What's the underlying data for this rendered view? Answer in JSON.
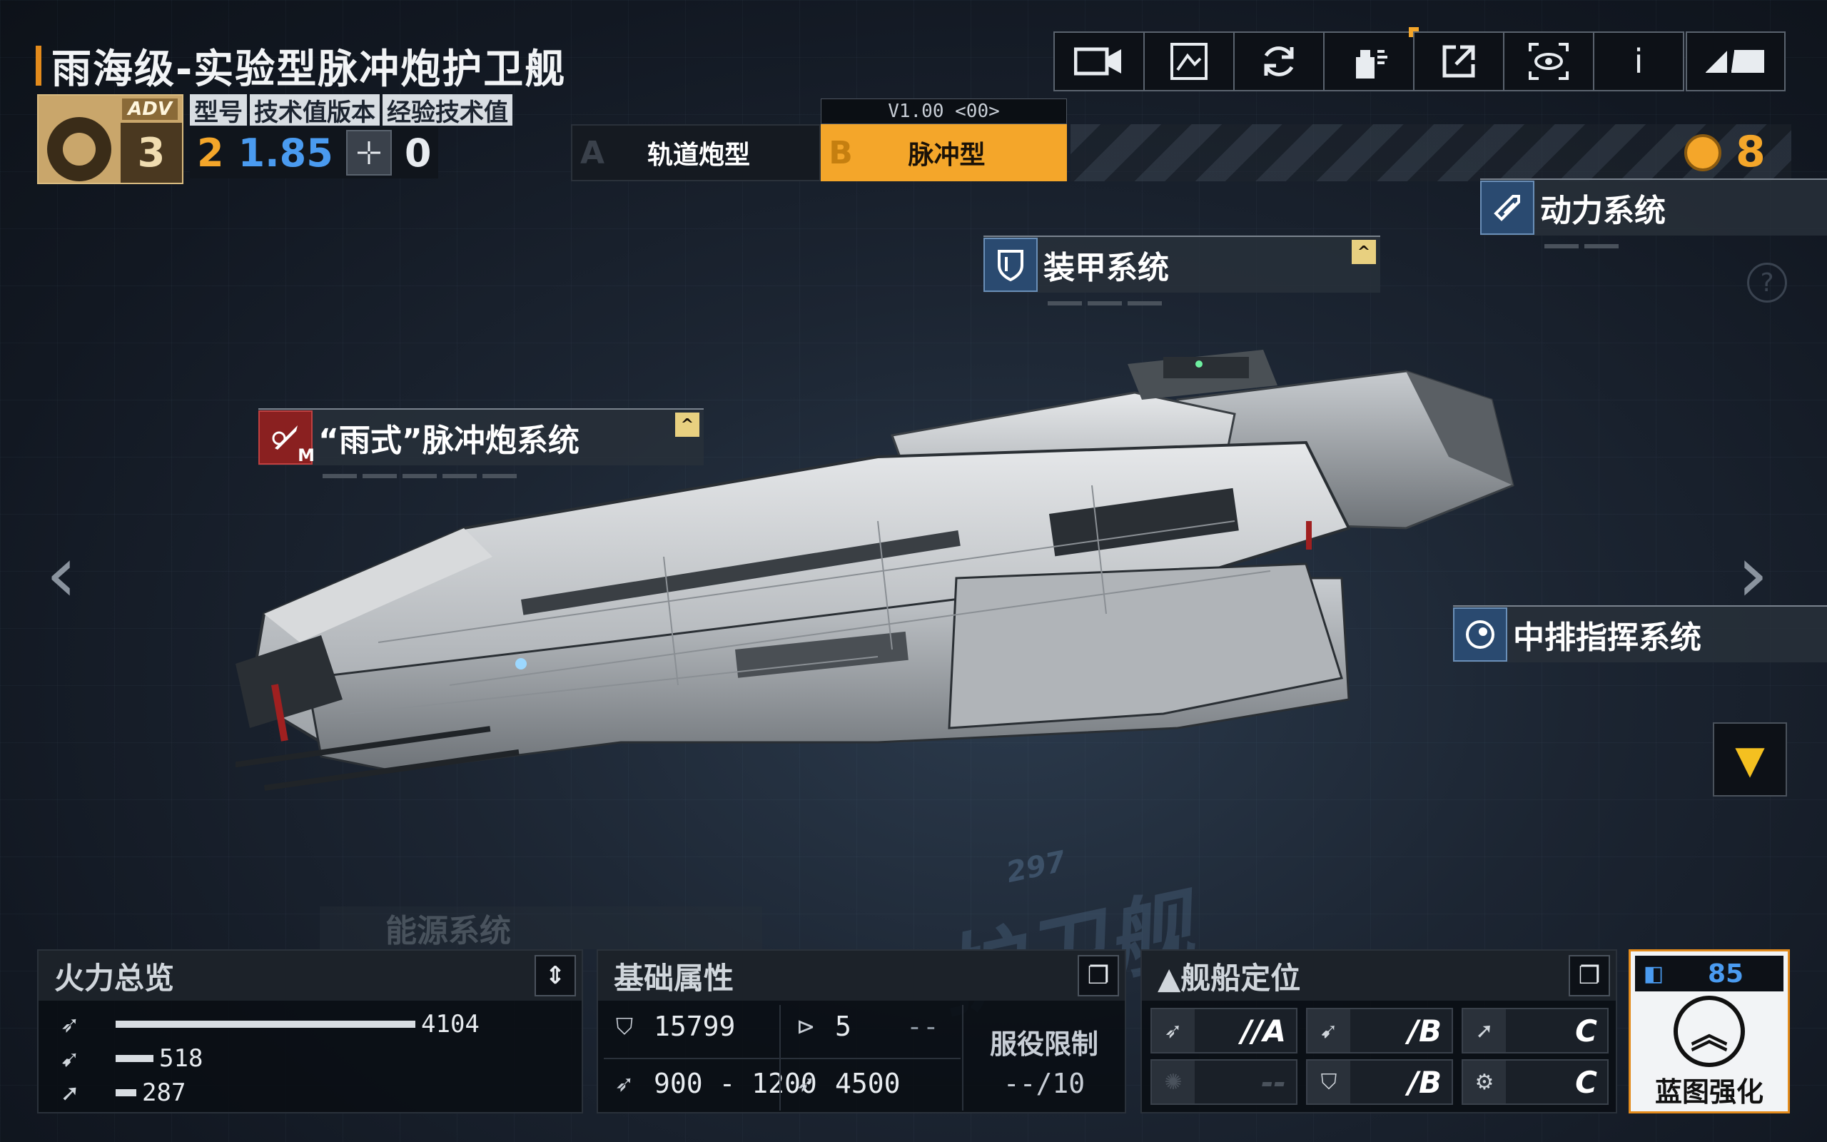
{
  "ship": {
    "title": "雨海级-实验型脉冲炮护卫舰",
    "adv_tag": "ADV",
    "adv_level": "3"
  },
  "stats": {
    "headers": [
      "型号",
      "技术值版本",
      "经验技术值"
    ],
    "model": "2",
    "tech_version": "1.85",
    "exp_tech": "0"
  },
  "variants": {
    "version": "V1.00 <00>",
    "a": {
      "letter": "A",
      "name": "轨道炮型"
    },
    "b": {
      "letter": "B",
      "name": "脉冲型"
    },
    "selected": "B"
  },
  "medals": {
    "count": "8"
  },
  "toolbar": {
    "icons": [
      "video-camera-icon",
      "blueprint-icon",
      "refresh-icon",
      "paint-spray-icon",
      "share-icon",
      "eye-scan-icon",
      "info-icon",
      "back-icon"
    ],
    "info_label": "i"
  },
  "systems": {
    "power": "动力系统",
    "armor": "装甲系统",
    "weapon": "“雨式”脉冲炮系统",
    "weapon_badge": "M",
    "command": "中排指挥系统",
    "energy": "能源系统"
  },
  "floor": {
    "number": "297",
    "text": "护卫舰"
  },
  "firepower": {
    "title": "火力总览",
    "rows": [
      {
        "icon": "anti-ship-icon",
        "value": 4104,
        "label": "4104"
      },
      {
        "icon": "anti-air-icon",
        "value": 518,
        "label": "518"
      },
      {
        "icon": "siege-icon",
        "value": 287,
        "label": "287"
      }
    ],
    "max": 4104
  },
  "base_attributes": {
    "title": "基础属性",
    "hp": "15799",
    "armor_slots": "5",
    "armor_extra": "--",
    "speed_range": "900 - 1200",
    "warp_speed": "4500",
    "service_limit_label": "服役限制",
    "service_limit_value": "--/10"
  },
  "positioning": {
    "title": "▲舰船定位",
    "cells": [
      {
        "icon": "anti-ship-icon",
        "grade": "//A",
        "dim": false
      },
      {
        "icon": "anti-air-icon",
        "grade": "/B",
        "dim": false
      },
      {
        "icon": "siege-icon",
        "grade": "C",
        "dim": false
      },
      {
        "icon": "support-icon",
        "grade": "--",
        "dim": true
      },
      {
        "icon": "defense-icon",
        "grade": "/B",
        "dim": false
      },
      {
        "icon": "gear-icon",
        "grade": "C",
        "dim": false
      }
    ]
  },
  "blueprint": {
    "value": "85",
    "label": "蓝图强化"
  },
  "colors": {
    "accent_orange": "#f4a62a",
    "accent_blue": "#4a9bf0",
    "panel_bg": "#0a0e14"
  }
}
